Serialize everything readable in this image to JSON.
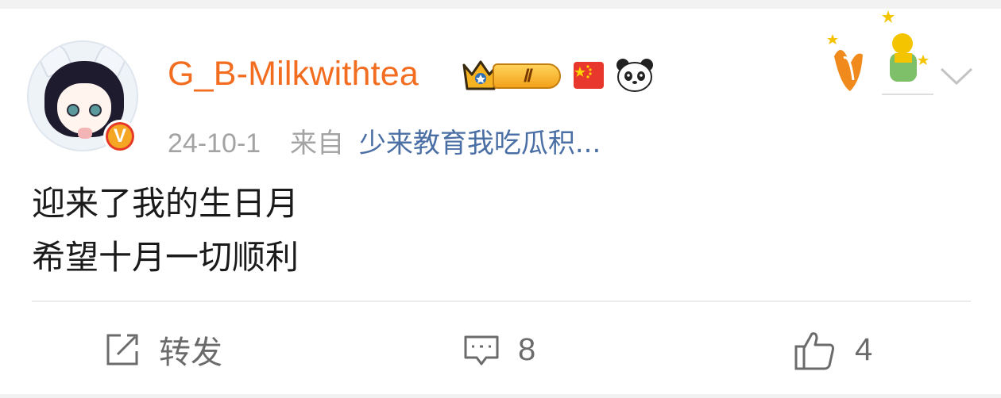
{
  "post": {
    "username": "G_B-Milkwithtea",
    "level_badge": "Ⅱ",
    "date": "24-10-1",
    "from_label": "来自",
    "source": "少来教育我吃瓜积...",
    "content_lines": [
      "迎来了我的生日月",
      "希望十月一切顺利"
    ],
    "verified_mark": "V"
  },
  "actions": {
    "forward_label": "转发",
    "comment_count": "8",
    "like_count": "4"
  },
  "colors": {
    "username": "#f26d1f",
    "source_link": "#4a6fa5",
    "meta_gray": "#a3a3a3",
    "action_gray": "#6b6b6b"
  },
  "icons": {
    "forward": "share-edit-icon",
    "comment": "comment-icon",
    "like": "thumbs-up-icon",
    "more": "chevron-down-icon"
  }
}
